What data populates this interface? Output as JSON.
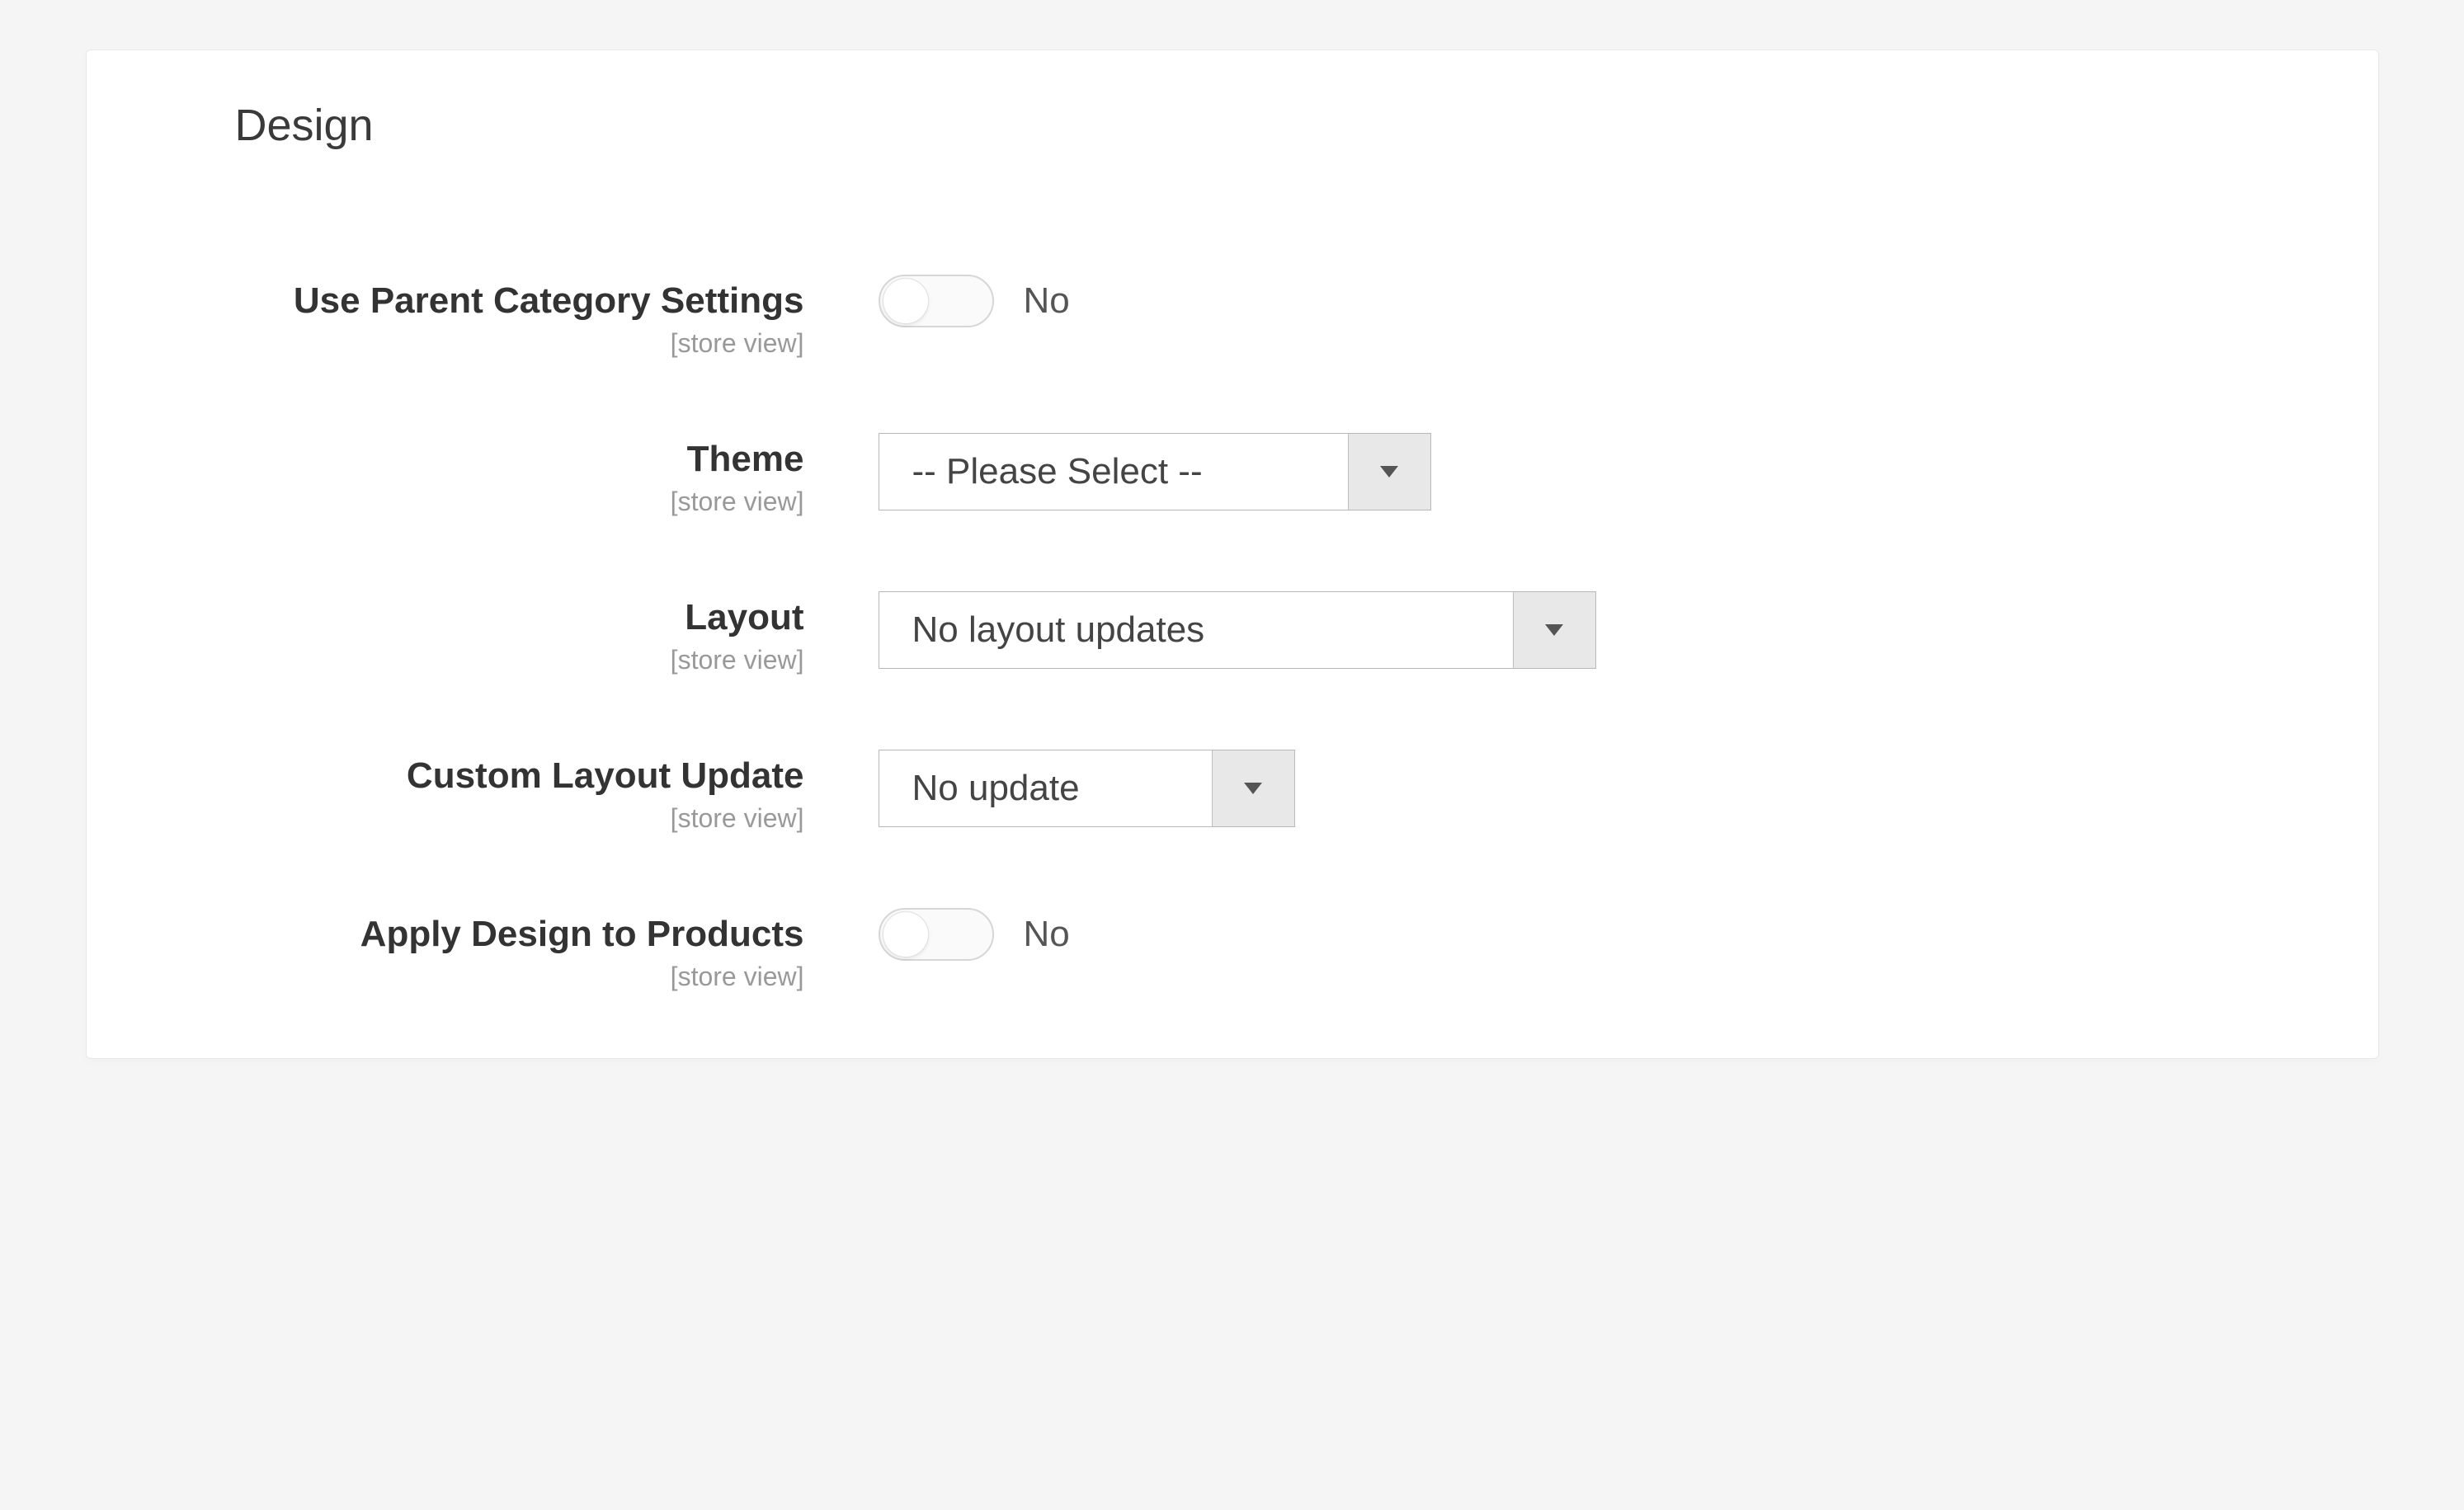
{
  "panel": {
    "title": "Design"
  },
  "fields": {
    "useParent": {
      "label": "Use Parent Category Settings",
      "scope": "[store view]",
      "value": "No"
    },
    "theme": {
      "label": "Theme",
      "scope": "[store view]",
      "value": "-- Please Select --"
    },
    "layout": {
      "label": "Layout",
      "scope": "[store view]",
      "value": "No layout updates"
    },
    "customLayout": {
      "label": "Custom Layout Update",
      "scope": "[store view]",
      "value": "No update"
    },
    "applyDesign": {
      "label": "Apply Design to Products",
      "scope": "[store view]",
      "value": "No"
    }
  }
}
